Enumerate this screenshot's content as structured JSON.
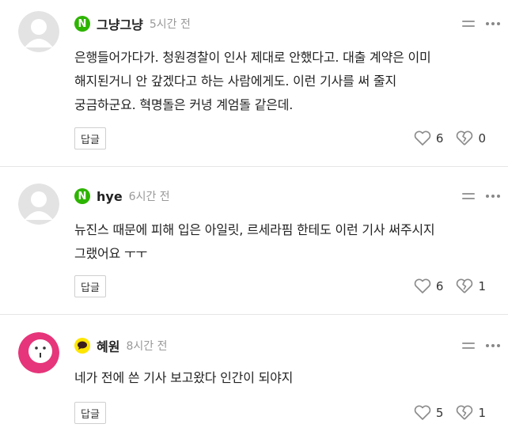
{
  "comments": [
    {
      "username": "그냥그냥",
      "badge": "N",
      "badge_color": "#2db400",
      "time": "5시간 전",
      "text": "은행들어가다가. 청원경찰이 인사 제대로 안했다고. 대출 계약은 이미\n해지된거니 안 갚겠다고 하는 사람에게도. 이런 기사를 써 줄지\n궁금하군요. 혁명돌은 커녕 계엄돌 같은데.",
      "reply_label": "답글",
      "likes": "6",
      "dislikes": "0"
    },
    {
      "username": "hye",
      "badge": "N",
      "badge_color": "#2db400",
      "time": "6시간 전",
      "text": "뉴진스 때문에 피해 입은 아일릿, 르세라핌 한테도 이런 기사 써주시지\n그랬어요 ㅜㅜ",
      "reply_label": "답글",
      "likes": "6",
      "dislikes": "1"
    },
    {
      "username": "혜원",
      "badge": "k-chat",
      "badge_color": "#fee500",
      "time": "8시간 전",
      "text": "네가 전에 쓴 기사 보고왔다 인간이 되야지",
      "reply_label": "답글",
      "likes": "5",
      "dislikes": "1"
    }
  ],
  "colors": {
    "naver_green": "#2db400",
    "kakao_yellow": "#fee500",
    "avatar_pink": "#e6357a",
    "divider": "#e6e6e6",
    "meta_gray": "#999999"
  },
  "icons": [
    "default-avatar-icon",
    "pink-face-avatar-icon",
    "naver-n-icon",
    "kakao-talk-icon",
    "menu-lines-icon",
    "more-dots-icon",
    "heart-icon",
    "broken-heart-icon"
  ]
}
